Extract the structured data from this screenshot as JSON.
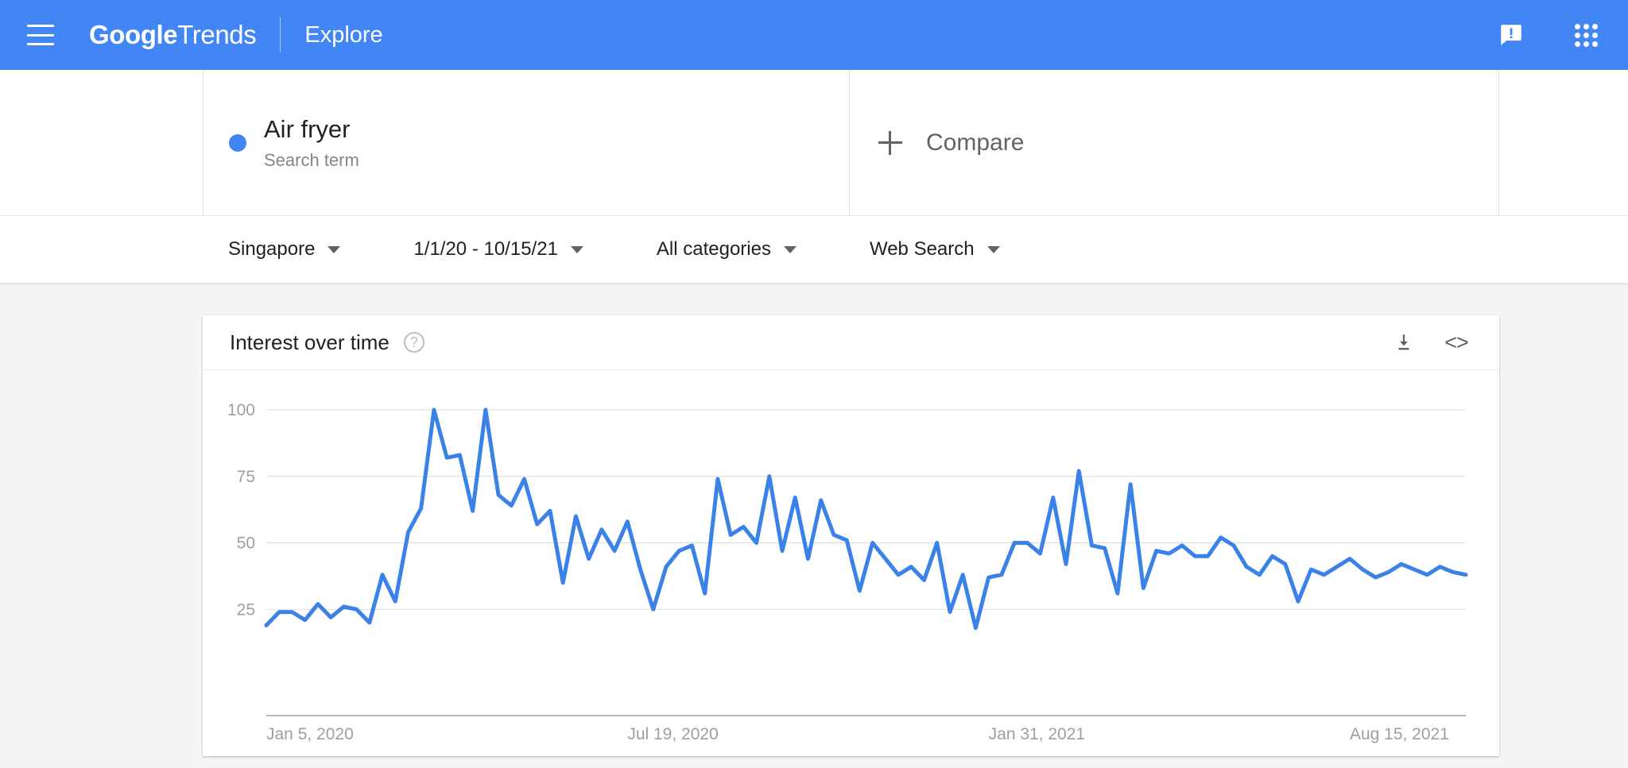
{
  "appbar": {
    "menu_icon": "hamburger-menu-icon",
    "brand_bold": "Google",
    "brand_light": "Trends",
    "explore": "Explore",
    "feedback_icon": "feedback-icon",
    "apps_icon": "google-apps-grid-icon",
    "background": "#4285F4"
  },
  "query": {
    "term": {
      "title": "Air fryer",
      "subtitle": "Search term",
      "dot_color": "#4285F4"
    },
    "compare": {
      "label": "Compare",
      "plus_icon": "plus-icon"
    }
  },
  "filters": [
    {
      "label": "Singapore"
    },
    {
      "label": "1/1/20 - 10/15/21"
    },
    {
      "label": "All categories"
    },
    {
      "label": "Web Search"
    }
  ],
  "chart_card": {
    "title": "Interest over time",
    "help_icon": "help-circle-icon",
    "download_icon": "download-icon",
    "embed_icon": "embed-code-icon",
    "embed_glyph": "<>"
  },
  "chart_data": {
    "type": "line",
    "title": "Interest over time",
    "xlabel": "",
    "ylabel": "",
    "ylim": [
      0,
      100
    ],
    "yticks": [
      25,
      50,
      75,
      100
    ],
    "ytick_labels": [
      "25",
      "50",
      "75",
      "100"
    ],
    "xtick_labels": [
      "Jan 5, 2020",
      "Jul 19, 2020",
      "Jan 31, 2021",
      "Aug 15, 2021"
    ],
    "xtick_indices": [
      0,
      28,
      56,
      84
    ],
    "grid": true,
    "legend": false,
    "line_color": "#3B82E8",
    "series": [
      {
        "name": "Air fryer",
        "color": "#3B82E8",
        "values": [
          19,
          24,
          24,
          21,
          27,
          22,
          26,
          25,
          20,
          38,
          28,
          54,
          63,
          100,
          82,
          83,
          62,
          100,
          68,
          64,
          74,
          57,
          62,
          35,
          60,
          44,
          55,
          47,
          58,
          40,
          25,
          41,
          47,
          49,
          31,
          74,
          53,
          56,
          50,
          75,
          47,
          67,
          44,
          66,
          53,
          51,
          32,
          50,
          44,
          38,
          41,
          36,
          50,
          24,
          38,
          18,
          37,
          38,
          50,
          50,
          46,
          67,
          42,
          77,
          49,
          48,
          31,
          72,
          33,
          47,
          46,
          49,
          45,
          45,
          52,
          49,
          41,
          38,
          45,
          42,
          28,
          40,
          38,
          41,
          44,
          40,
          37,
          39,
          42,
          40,
          38,
          41,
          39,
          38
        ]
      }
    ]
  }
}
